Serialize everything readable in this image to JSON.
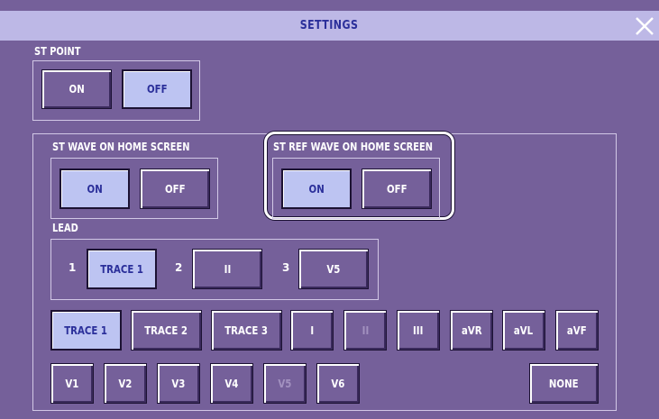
{
  "window": {
    "title": "SETTINGS",
    "close_icon": "close-x-icon"
  },
  "st_point": {
    "label": "ST POINT",
    "on": "ON",
    "off": "OFF",
    "selected": "OFF"
  },
  "st_wave": {
    "label": "ST WAVE ON HOME SCREEN",
    "on": "ON",
    "off": "OFF",
    "selected": "ON"
  },
  "st_ref_wave": {
    "label": "ST REF WAVE ON HOME SCREEN",
    "on": "ON",
    "off": "OFF",
    "selected": "ON"
  },
  "lead": {
    "label": "LEAD",
    "slots": [
      {
        "num": "1",
        "value": "TRACE 1"
      },
      {
        "num": "2",
        "value": "II"
      },
      {
        "num": "3",
        "value": "V5"
      }
    ]
  },
  "lead_options_row1": [
    "TRACE 1",
    "TRACE 2",
    "TRACE 3",
    "I",
    "II",
    "III",
    "aVR",
    "aVL",
    "aVF"
  ],
  "lead_options_row2": [
    "V1",
    "V2",
    "V3",
    "V4",
    "V5",
    "V6"
  ],
  "none_label": "NONE",
  "colors": {
    "background": "#75609a",
    "title_bar": "#bdb8e6",
    "title_text": "#2b2f9a",
    "selected_button": "#bdc4f2"
  }
}
